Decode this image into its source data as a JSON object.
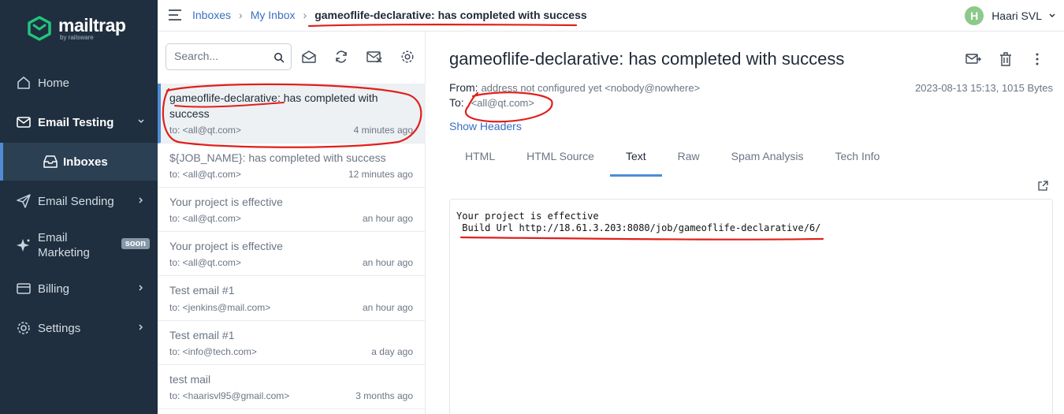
{
  "brand": {
    "name": "mailtrap",
    "sub": "by railsware"
  },
  "sidebar": {
    "items": [
      {
        "label": "Home",
        "icon": "home-icon"
      },
      {
        "label": "Email Testing",
        "icon": "mail-check-icon"
      },
      {
        "label": "Inboxes",
        "icon": "inbox-icon"
      },
      {
        "label": "Email Sending",
        "icon": "send-icon"
      },
      {
        "label": "Email",
        "label2": "Marketing",
        "icon": "sparkle-icon",
        "badge": "soon"
      },
      {
        "label": "Billing",
        "icon": "card-icon"
      },
      {
        "label": "Settings",
        "icon": "gear-icon"
      }
    ]
  },
  "breadcrumb": {
    "first": "Inboxes",
    "second": "My Inbox",
    "current": "gameoflife-declarative: has completed with success"
  },
  "user": {
    "initial": "H",
    "name": "Haari SVL"
  },
  "search": {
    "placeholder": "Search..."
  },
  "messages": [
    {
      "subject": "gameoflife-declarative: has completed with success",
      "to": "to: <all@qt.com>",
      "time": "4 minutes ago"
    },
    {
      "subject": "${JOB_NAME}: has completed with success",
      "to": "to: <all@qt.com>",
      "time": "12 minutes ago"
    },
    {
      "subject": "Your project is effective",
      "to": "to: <all@qt.com>",
      "time": "an hour ago"
    },
    {
      "subject": "Your project is effective",
      "to": "to: <all@qt.com>",
      "time": "an hour ago"
    },
    {
      "subject": "Test email #1",
      "to": "to: <jenkins@mail.com>",
      "time": "an hour ago"
    },
    {
      "subject": "Test email #1",
      "to": "to: <info@tech.com>",
      "time": "a day ago"
    },
    {
      "subject": "test mail",
      "to": "to: <haarisvl95@gmail.com>",
      "time": "3 months ago"
    }
  ],
  "detail": {
    "subject": "gameoflife-declarative: has completed with success",
    "from_label": "From:",
    "from_value": "address not configured yet <nobody@nowhere>",
    "to_label": "To:",
    "to_value": "<all@qt.com>",
    "meta": "2023-08-13 15:13, 1015 Bytes",
    "show_headers": "Show Headers",
    "tabs": [
      "HTML",
      "HTML Source",
      "Text",
      "Raw",
      "Spam Analysis",
      "Tech Info"
    ],
    "active_tab": "Text",
    "body": "Your project is effective\n Build Url http://18.61.3.203:8080/job/gameoflife-declarative/6/"
  },
  "colors": {
    "sidebar_bg": "#1f2f3f",
    "accent": "#4f8cd6",
    "brand_green": "#22c47e",
    "annotation": "#e0201c"
  }
}
